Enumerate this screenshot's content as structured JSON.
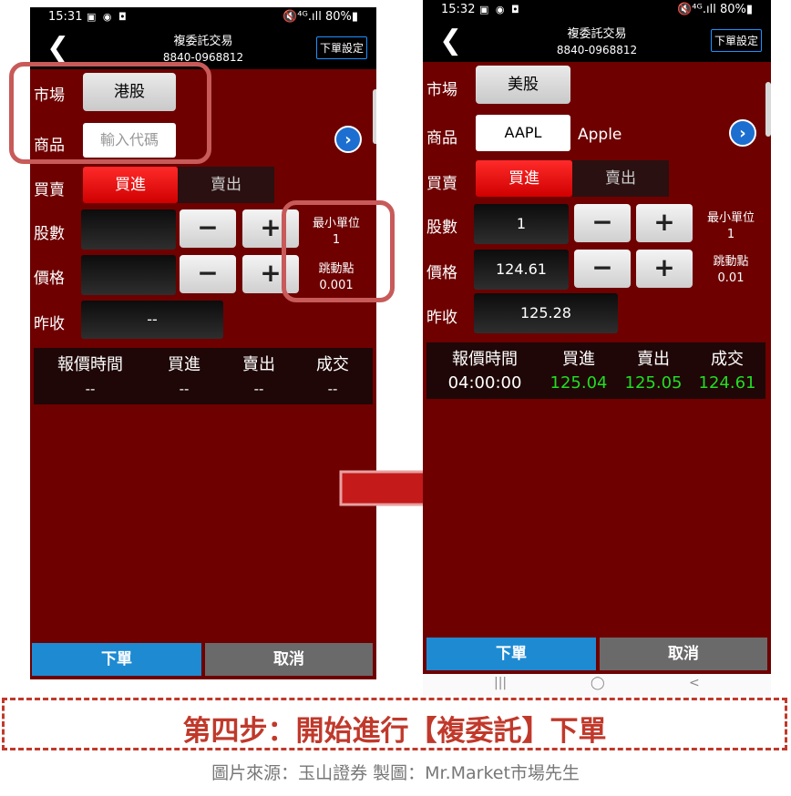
{
  "left_screen": {
    "status_time": "15:31",
    "status_right": "🔇⁴ᴳ.ıll 80%▮",
    "title": "複委託交易",
    "account": "8840-0968812",
    "settings_label": "下單設定",
    "market_label": "市場",
    "market_value": "港股",
    "product_label": "商品",
    "product_placeholder": "輸入代碼",
    "side_label": "買賣",
    "buy_label": "買進",
    "sell_label": "賣出",
    "qty_label": "股數",
    "price_label": "價格",
    "prev_close_label": "昨收",
    "prev_close_value": "--",
    "min_unit_label": "最小單位",
    "min_unit_value": "1",
    "tick_label": "跳動點",
    "tick_value": "0.001",
    "table_headers": [
      "報價時間",
      "買進",
      "賣出",
      "成交"
    ],
    "table_values": [
      "--",
      "--",
      "--",
      "--"
    ],
    "order_button": "下單",
    "cancel_button": "取消"
  },
  "right_screen": {
    "status_time": "15:32",
    "status_right": "🔇⁴ᴳ.ıll 80%▮",
    "title": "複委託交易",
    "account": "8840-0968812",
    "settings_label": "下單設定",
    "market_label": "市場",
    "market_value": "美股",
    "product_label": "商品",
    "product_code": "AAPL",
    "product_name": "Apple",
    "side_label": "買賣",
    "buy_label": "買進",
    "sell_label": "賣出",
    "qty_label": "股數",
    "qty_value": "1",
    "price_label": "價格",
    "price_value": "124.61",
    "prev_close_label": "昨收",
    "prev_close_value": "125.28",
    "min_unit_label": "最小單位",
    "min_unit_value": "1",
    "tick_label": "跳動點",
    "tick_value": "0.01",
    "table_headers": [
      "報價時間",
      "買進",
      "賣出",
      "成交"
    ],
    "table_values": [
      "04:00:00",
      "125.04",
      "125.05",
      "124.61"
    ],
    "order_button": "下單",
    "cancel_button": "取消",
    "nav_items": [
      "|||",
      "◯",
      "<"
    ]
  },
  "caption": "第四步：開始進行【複委託】下單",
  "source": "圖片來源：玉山證券 製圖：Mr.Market市場先生",
  "colors": {
    "background_red": "#6e0000",
    "buy_red": "#ff1a1a",
    "quote_green": "#22dd22",
    "order_blue": "#1e8ad2",
    "highlight": "#c85a5a",
    "caption_red": "#c0392b"
  }
}
